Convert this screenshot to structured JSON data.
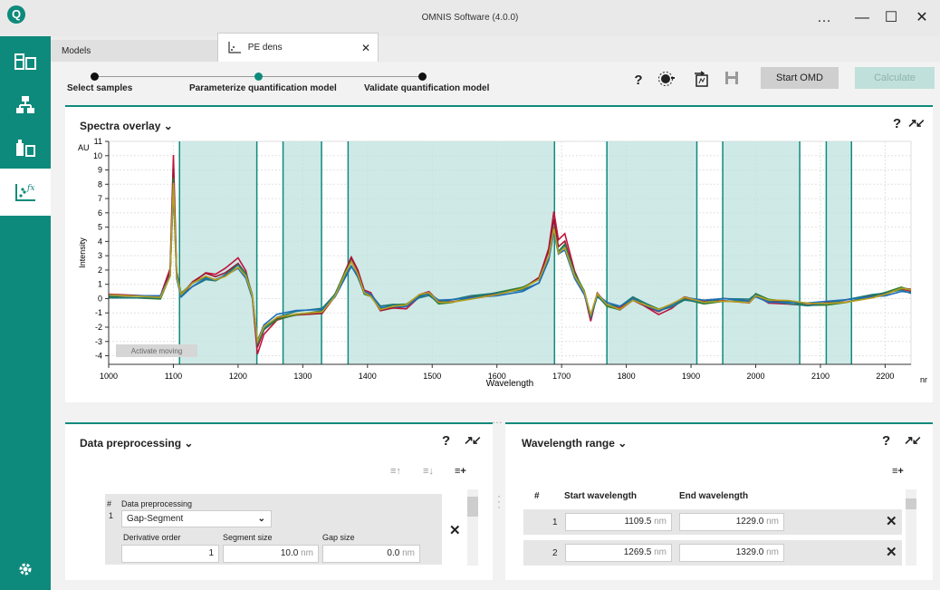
{
  "app": {
    "logo": "Q",
    "title": "OMNIS Software (4.0.0)",
    "more": "…",
    "minimize": "—",
    "maximize": "☐",
    "close": "✕"
  },
  "rail": {
    "items": [
      "samples-icon",
      "workflow-icon",
      "reagents-icon",
      "models-icon"
    ],
    "settings": "gear-icon"
  },
  "tabs": {
    "models": "Models",
    "pe": "PE dens",
    "close": "✕"
  },
  "stepper": {
    "steps": [
      "Select samples",
      "Parameterize quantification model",
      "Validate quantification model"
    ],
    "active": 1
  },
  "toolbar": {
    "help": "?",
    "start_omd": "Start OMD",
    "calculate": "Calculate"
  },
  "spectra": {
    "title": "Spectra overlay",
    "help": "?",
    "activate_moving": "Activate moving"
  },
  "chart_data": {
    "type": "line",
    "title": "",
    "xlabel": "Wavelength",
    "ylabel": "Intensity",
    "x_unit": "nm",
    "y_unit": "AU",
    "xlim": [
      1000,
      2240
    ],
    "ylim": [
      -4.6,
      11
    ],
    "x_ticks": [
      1000,
      1100,
      1200,
      1300,
      1400,
      1500,
      1600,
      1700,
      1800,
      1900,
      2000,
      2100,
      2200
    ],
    "y_ticks": [
      -4,
      -3,
      -2,
      -1,
      0,
      1,
      2,
      3,
      4,
      5,
      6,
      7,
      8,
      9,
      10,
      11
    ],
    "grid": true,
    "selected_ranges": [
      [
        1109.5,
        1229.0
      ],
      [
        1269.5,
        1329.0
      ],
      [
        1370,
        1689
      ],
      [
        1770,
        1909
      ],
      [
        1949,
        2068
      ],
      [
        2109,
        2148
      ]
    ],
    "series_peaks": [
      {
        "color": "#c0143c",
        "scale": 1.0
      },
      {
        "color": "#a01432",
        "scale": 0.92
      },
      {
        "color": "#2e7d32",
        "scale": 0.85
      },
      {
        "color": "#1f7a7a",
        "scale": 0.8
      },
      {
        "color": "#1e6fb8",
        "scale": 0.76
      },
      {
        "color": "#b8a020",
        "scale": 0.82
      }
    ],
    "profile": [
      [
        1000,
        0.2
      ],
      [
        1080,
        0.1
      ],
      [
        1095,
        2
      ],
      [
        1100,
        10
      ],
      [
        1105,
        2
      ],
      [
        1112,
        0.3
      ],
      [
        1130,
        1.2
      ],
      [
        1150,
        1.8
      ],
      [
        1165,
        1.6
      ],
      [
        1180,
        2.0
      ],
      [
        1200,
        2.8
      ],
      [
        1212,
        2.0
      ],
      [
        1222,
        0.2
      ],
      [
        1230,
        -3.8
      ],
      [
        1240,
        -2.5
      ],
      [
        1260,
        -1.6
      ],
      [
        1290,
        -1.2
      ],
      [
        1330,
        -1.0
      ],
      [
        1350,
        0.3
      ],
      [
        1365,
        2.0
      ],
      [
        1375,
        3.0
      ],
      [
        1385,
        2.0
      ],
      [
        1395,
        0.5
      ],
      [
        1405,
        0.3
      ],
      [
        1420,
        -0.8
      ],
      [
        1440,
        -0.6
      ],
      [
        1460,
        -0.6
      ],
      [
        1480,
        0.2
      ],
      [
        1495,
        0.4
      ],
      [
        1510,
        -0.3
      ],
      [
        1530,
        -0.2
      ],
      [
        1560,
        0.1
      ],
      [
        1600,
        0.4
      ],
      [
        1640,
        0.8
      ],
      [
        1665,
        1.5
      ],
      [
        1680,
        3.5
      ],
      [
        1688,
        6.0
      ],
      [
        1695,
        4.0
      ],
      [
        1705,
        4.5
      ],
      [
        1720,
        2.0
      ],
      [
        1735,
        0.5
      ],
      [
        1745,
        -1.5
      ],
      [
        1755,
        0.3
      ],
      [
        1770,
        -0.5
      ],
      [
        1790,
        -0.8
      ],
      [
        1810,
        0.0
      ],
      [
        1830,
        -0.5
      ],
      [
        1850,
        -1.0
      ],
      [
        1870,
        -0.6
      ],
      [
        1890,
        0.0
      ],
      [
        1920,
        -0.3
      ],
      [
        1950,
        -0.1
      ],
      [
        1990,
        -0.2
      ],
      [
        2000,
        0.3
      ],
      [
        2020,
        -0.2
      ],
      [
        2050,
        -0.3
      ],
      [
        2080,
        -0.5
      ],
      [
        2110,
        -0.4
      ],
      [
        2140,
        -0.2
      ],
      [
        2180,
        0.2
      ],
      [
        2200,
        0.4
      ],
      [
        2225,
        0.8
      ],
      [
        2240,
        0.6
      ]
    ]
  },
  "preprocessing": {
    "title": "Data preprocessing",
    "help": "?",
    "col_hash": "#",
    "col_label": "Data preprocessing",
    "row_index": "1",
    "method": "Gap-Segment",
    "derivative_label": "Derivative order",
    "derivative_value": "1",
    "segment_label": "Segment size",
    "segment_value": "10.0",
    "gap_label": "Gap size",
    "gap_value": "0.0",
    "unit": "nm"
  },
  "wavelength": {
    "title": "Wavelength range",
    "help": "?",
    "col_hash": "#",
    "col_start": "Start wavelength",
    "col_end": "End wavelength",
    "unit": "nm",
    "rows": [
      {
        "index": "1",
        "start": "1109.5",
        "end": "1229.0"
      },
      {
        "index": "2",
        "start": "1269.5",
        "end": "1329.0"
      }
    ]
  }
}
